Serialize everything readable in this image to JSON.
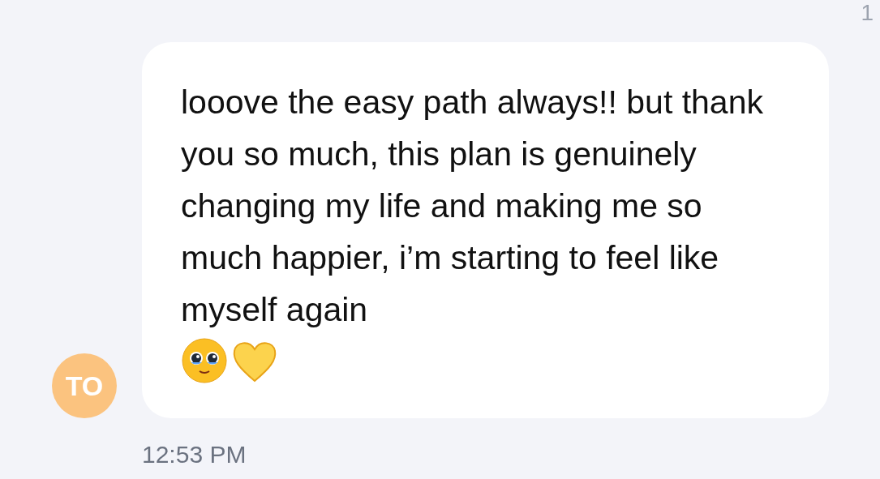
{
  "corner_time": "1",
  "message": {
    "text": "looove the easy path always!! but thank you so much, this plan is genuinely changing my life and making me so much happier, i’m starting to feel like myself again",
    "sender_initials": "TO",
    "time": "12:53 PM"
  }
}
